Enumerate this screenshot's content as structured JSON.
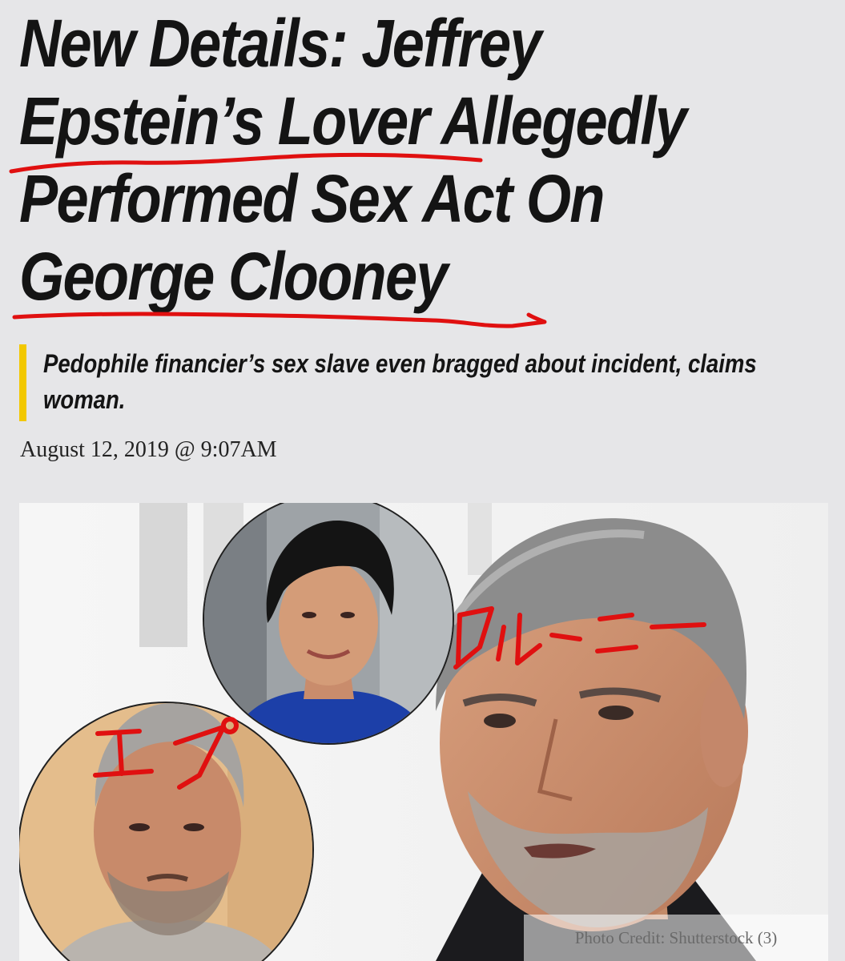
{
  "headline": {
    "line1": "New Details: Jeffrey",
    "line2": "Epstein’s Lover Allegedly",
    "line3": "Performed Sex Act On",
    "line4": "George Clooney"
  },
  "subheadline": "Pedophile financier’s sex slave even bragged about incident, claims woman.",
  "byline": "August 12, 2019 @ 9:07AM",
  "photo": {
    "credit": "Photo Credit: Shutterstock (3)",
    "annotation_right": "クルーニー",
    "annotation_left": "エプ"
  },
  "colors": {
    "background": "#e6e6e8",
    "headline": "#141414",
    "accent_bar": "#f2c800",
    "handwriting": "#e01010"
  },
  "icons": {
    "dek_accent": "vertical-bar"
  }
}
